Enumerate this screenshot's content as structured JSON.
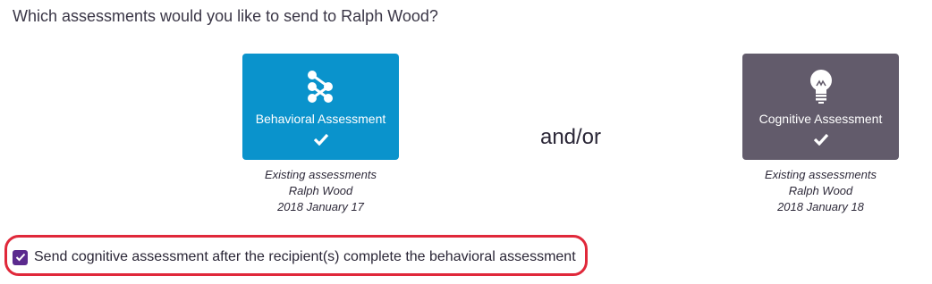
{
  "question": "Which assessments would you like to send to Ralph Wood?",
  "connector_text": "and/or",
  "assessments": [
    {
      "label": "Behavioral Assessment",
      "icon": "share-nodes-icon",
      "selected": true,
      "color": "#0a93cc",
      "existing_title": "Existing assessments",
      "recipient": "Ralph Wood",
      "date": "2018 January 17"
    },
    {
      "label": "Cognitive Assessment",
      "icon": "lightbulb-icon",
      "selected": true,
      "color": "#625b6b",
      "existing_title": "Existing assessments",
      "recipient": "Ralph Wood",
      "date": "2018 January 18"
    }
  ],
  "option": {
    "checked": true,
    "label": "Send cognitive assessment after the recipient(s) complete the behavioral assessment"
  },
  "colors": {
    "checkbox": "#5b2a8e",
    "highlight_border": "#e0283a"
  }
}
